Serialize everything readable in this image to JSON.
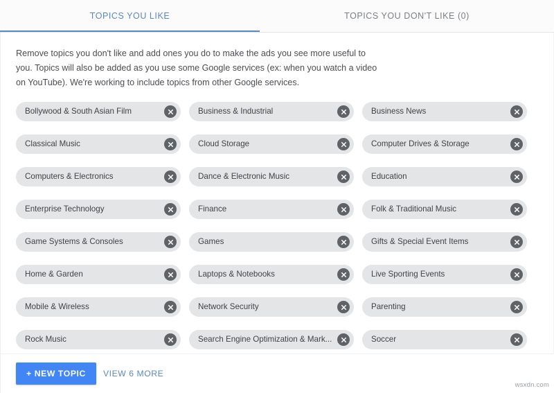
{
  "tabs": [
    {
      "id": "liked",
      "label": "TOPICS YOU LIKE",
      "active": true
    },
    {
      "id": "disliked",
      "label": "TOPICS YOU DON'T LIKE (0)",
      "active": false
    }
  ],
  "description": "Remove topics you don't like and add ones you do to make the ads you see more useful to you. Topics will also be added as you use some Google services (ex: when you watch a video on YouTube). We're working to include topics from other Google services.",
  "topics": [
    "Bollywood & South Asian Film",
    "Business & Industrial",
    "Business News",
    "Classical Music",
    "Cloud Storage",
    "Computer Drives & Storage",
    "Computers & Electronics",
    "Dance & Electronic Music",
    "Education",
    "Enterprise Technology",
    "Finance",
    "Folk & Traditional Music",
    "Game Systems & Consoles",
    "Games",
    "Gifts & Special Event Items",
    "Home & Garden",
    "Laptops & Notebooks",
    "Live Sporting Events",
    "Mobile & Wireless",
    "Network Security",
    "Parenting",
    "Rock Music",
    "Search Engine Optimization & Mark...",
    "Soccer"
  ],
  "remove_icon": "close-circle-icon",
  "footer": {
    "new_topic_label": "+ NEW TOPIC",
    "view_more_label": "VIEW 6 MORE"
  },
  "watermark": "wsxdn.com",
  "colors": {
    "accent_blue": "#4285f4",
    "tab_active": "#5b87c7",
    "tab_inactive": "#7b7f85",
    "chip_background": "#e4e5e7",
    "chip_text": "#3f4347",
    "remove_icon_bg": "#5f6368"
  }
}
